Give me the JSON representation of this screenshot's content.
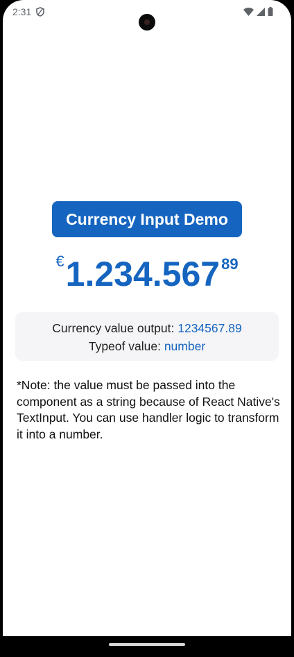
{
  "status_bar": {
    "time": "2:31",
    "icons": [
      "shield-icon",
      "wifi-icon",
      "signal-icon",
      "battery-icon"
    ]
  },
  "main": {
    "demo_button_label": "Currency Input Demo",
    "currency": {
      "symbol": "€",
      "integer_part": "1.234.567",
      "decimal_part": "89"
    },
    "output": {
      "currency_label": "Currency value output: ",
      "currency_value": "1234567.89",
      "typeof_label": "Typeof value: ",
      "typeof_value": "number"
    },
    "note": "*Note: the value must be passed into the component as a string because of React Native's TextInput. You can use handler logic to transform it into a number."
  },
  "colors": {
    "accent": "#1565c0",
    "output_background": "#f5f5f7",
    "text": "#111111"
  }
}
